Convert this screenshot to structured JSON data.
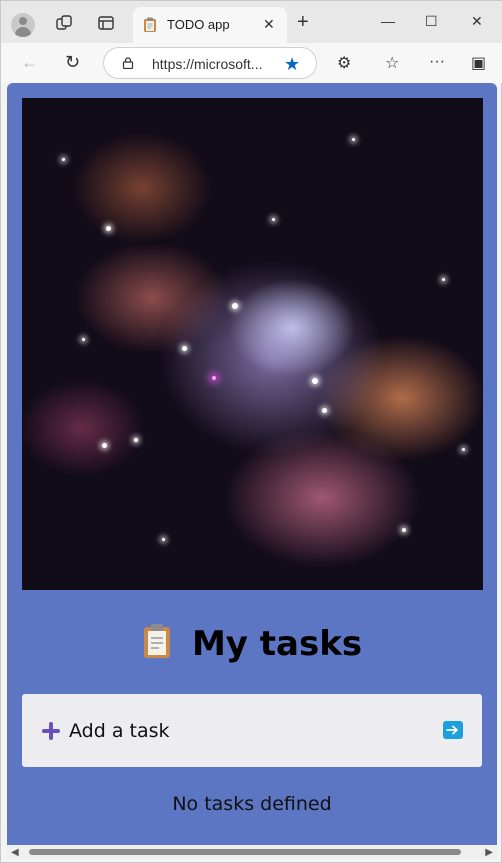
{
  "browser": {
    "tab_title": "TODO app",
    "url": "https://microsoft...",
    "tab_close_glyph": "✕",
    "new_tab_glyph": "+",
    "minimize_glyph": "—",
    "maximize_glyph": "☐",
    "close_glyph": "✕",
    "back_glyph": "←",
    "refresh_glyph": "↻",
    "favorite_glyph": "★",
    "extensions_glyph": "⚙",
    "favorites_glyph": "☆",
    "more_glyph": "···",
    "sidebar_glyph": "▣"
  },
  "page": {
    "heading": "My tasks",
    "add_task_label": "Add a task",
    "empty_message": "No tasks defined",
    "background_color": "#5d76c4",
    "hero_image": "nebula-image"
  },
  "icons": [
    "profile-icon",
    "workspaces-icon",
    "tab-actions-icon",
    "clipboard-icon",
    "plus-icon",
    "arrow-right-icon",
    "lock-icon",
    "star-icon"
  ]
}
